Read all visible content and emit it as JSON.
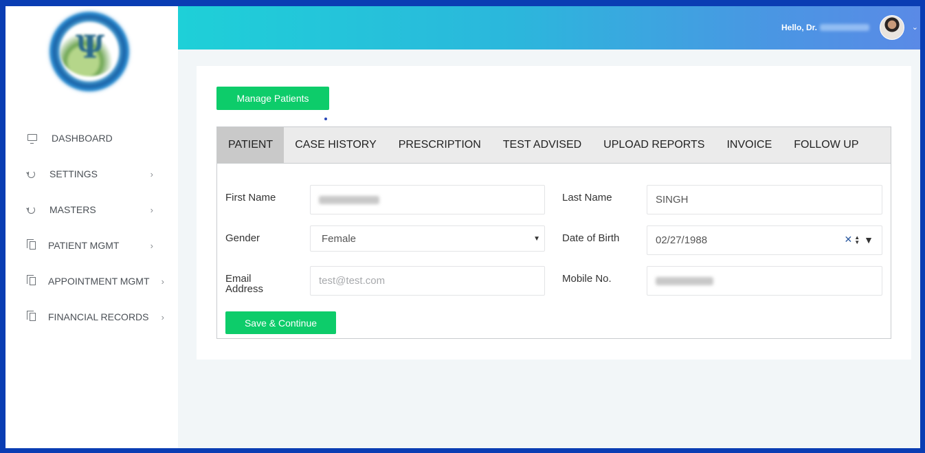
{
  "colors": {
    "accent_green": "#0dcc6a",
    "topbar_start": "#1ed0d8",
    "topbar_end": "#5a8ae6",
    "frame_border": "#0a3db3"
  },
  "sidebar": {
    "logo_icon": "clinic-logo",
    "items": [
      {
        "label": "DASHBOARD",
        "icon": "monitor-icon",
        "has_submenu": false
      },
      {
        "label": "SETTINGS",
        "icon": "refresh-icon",
        "has_submenu": true
      },
      {
        "label": "MASTERS",
        "icon": "refresh-icon",
        "has_submenu": true
      },
      {
        "label": "PATIENT MGMT",
        "icon": "copy-icon",
        "has_submenu": true
      },
      {
        "label": "APPOINTMENT MGMT",
        "icon": "copy-icon",
        "has_submenu": true
      },
      {
        "label": "FINANCIAL RECORDS",
        "icon": "copy-icon",
        "has_submenu": true
      }
    ],
    "chevron": "›"
  },
  "header": {
    "greeting": "Hello, Dr.",
    "user_menu_caret": "⌄"
  },
  "main": {
    "manage_button": "Manage Patients",
    "tabs": [
      {
        "label": "PATIENT",
        "active": true
      },
      {
        "label": "CASE HISTORY",
        "active": false
      },
      {
        "label": "PRESCRIPTION",
        "active": false
      },
      {
        "label": "TEST ADVISED",
        "active": false
      },
      {
        "label": "UPLOAD REPORTS",
        "active": false
      },
      {
        "label": "INVOICE",
        "active": false
      },
      {
        "label": "FOLLOW UP",
        "active": false
      }
    ],
    "form": {
      "first_name_label": "First Name",
      "last_name_label": "Last Name",
      "last_name_value": "SINGH",
      "gender_label": "Gender",
      "gender_value": "Female",
      "dob_label": "Date of Birth",
      "dob_value": "02/27/1988",
      "dob_clear": "✕",
      "dob_up": "▲",
      "dob_down": "▼",
      "dob_dropdown": "▼",
      "email_label": "Email\nAddress",
      "email_label_line1": "Email",
      "email_label_line2": "Address",
      "email_placeholder": "test@test.com",
      "mobile_label": "Mobile No.",
      "select_caret": "▼"
    },
    "save_button": "Save & Continue"
  }
}
